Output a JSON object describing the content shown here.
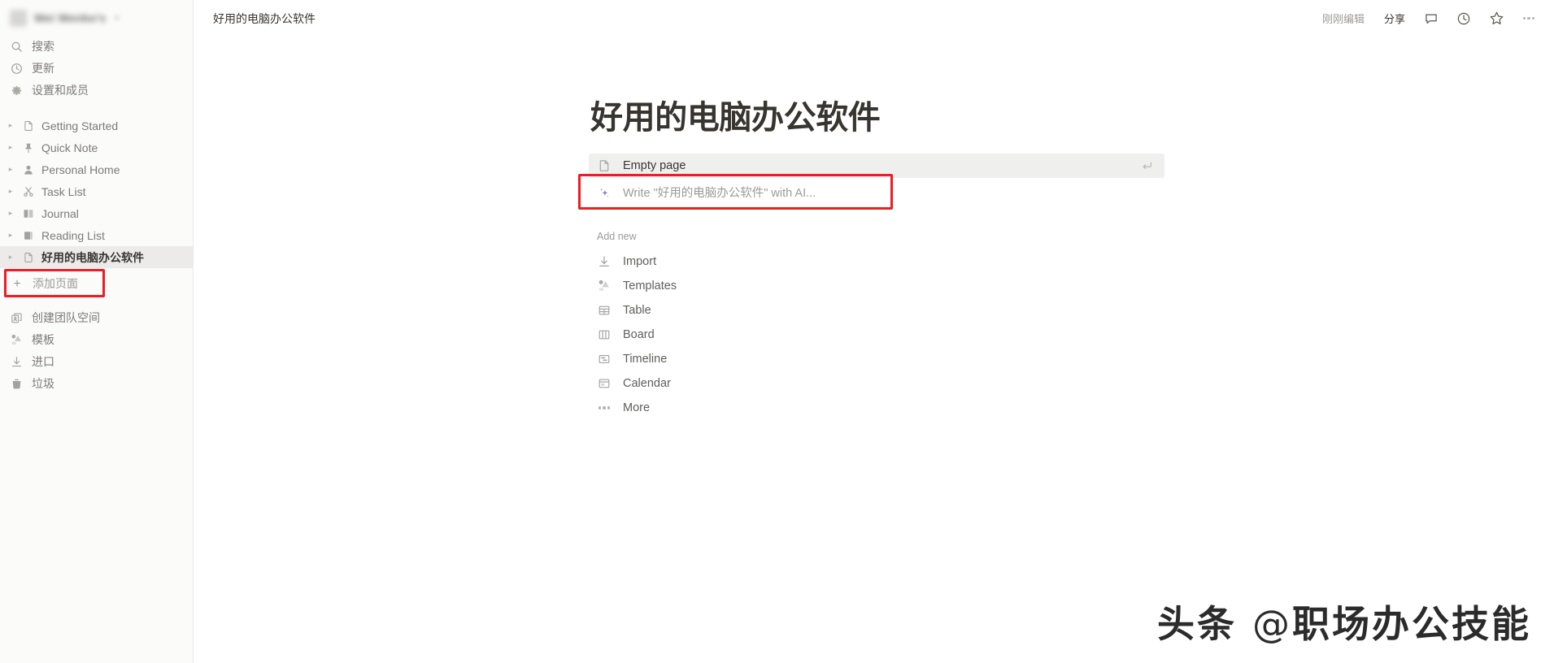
{
  "sidebar": {
    "workspace": {
      "name": "Wei Wenbo's",
      "caret_icon": "chevron-down-icon",
      "redacted": true
    },
    "quick_actions": [
      {
        "label": "搜索",
        "icon": "search-icon"
      },
      {
        "label": "更新",
        "icon": "clock-update-icon"
      },
      {
        "label": "设置和成员",
        "icon": "gear-icon"
      }
    ],
    "pages": [
      {
        "label": "Getting Started",
        "icon": "page-icon",
        "caret": "chevron-right-icon",
        "selected": false
      },
      {
        "label": "Quick Note",
        "icon": "pin-icon",
        "caret": "chevron-right-icon",
        "selected": false
      },
      {
        "label": "Personal Home",
        "icon": "person-icon",
        "caret": "chevron-right-icon",
        "selected": false
      },
      {
        "label": "Task List",
        "icon": "scissors-icon",
        "caret": "chevron-right-icon",
        "selected": false
      },
      {
        "label": "Journal",
        "icon": "open-book-icon",
        "caret": "chevron-right-icon",
        "selected": false
      },
      {
        "label": "Reading List",
        "icon": "closed-book-icon",
        "caret": "chevron-right-icon",
        "selected": false
      },
      {
        "label": "好用的电脑办公软件",
        "icon": "page-icon",
        "caret": "chevron-right-icon",
        "selected": true
      }
    ],
    "add_page": {
      "label": "添加页面",
      "icon": "plus-icon",
      "highlighted": true
    },
    "bottom_items": [
      {
        "label": "创建团队空间",
        "icon": "teamspace-icon"
      },
      {
        "label": "模板",
        "icon": "templates-icon"
      },
      {
        "label": "进口",
        "icon": "import-icon"
      },
      {
        "label": "垃圾",
        "icon": "trash-icon"
      }
    ]
  },
  "topbar": {
    "breadcrumb": "好用的电脑办公软件",
    "edited_status": "刚刚编辑",
    "share_label": "分享",
    "icons": [
      {
        "name": "comment-icon"
      },
      {
        "name": "clock-history-icon"
      },
      {
        "name": "star-icon"
      },
      {
        "name": "more-horizontal-icon"
      }
    ]
  },
  "page": {
    "title": "好用的电脑办公软件",
    "menu_options": [
      {
        "label": "Empty page",
        "icon": "page-icon",
        "active": true,
        "shortcut_icon": "enter-key-icon"
      },
      {
        "label": "Write \"好用的电脑办公软件\" with AI...",
        "icon": "ai-sparkle-icon",
        "active": false,
        "highlighted": true
      }
    ],
    "add_new_label": "Add new",
    "add_new_items": [
      {
        "label": "Import",
        "icon": "import-arrow-icon"
      },
      {
        "label": "Templates",
        "icon": "templates-icon"
      },
      {
        "label": "Table",
        "icon": "table-icon"
      },
      {
        "label": "Board",
        "icon": "board-icon"
      },
      {
        "label": "Timeline",
        "icon": "timeline-icon"
      },
      {
        "label": "Calendar",
        "icon": "calendar-icon"
      },
      {
        "label": "More",
        "icon": "more-dots-icon"
      }
    ]
  },
  "watermark": {
    "prefix": "头条",
    "at": "@",
    "handle": "职场办公技能"
  },
  "colors": {
    "annotation_red": "#ef1c24",
    "ai_purple": "#8b7bc4",
    "sidebar_bg": "#fbfbfa",
    "selected_row": "#ecebea",
    "text_primary": "#37352f",
    "text_muted": "#9b9a97"
  }
}
